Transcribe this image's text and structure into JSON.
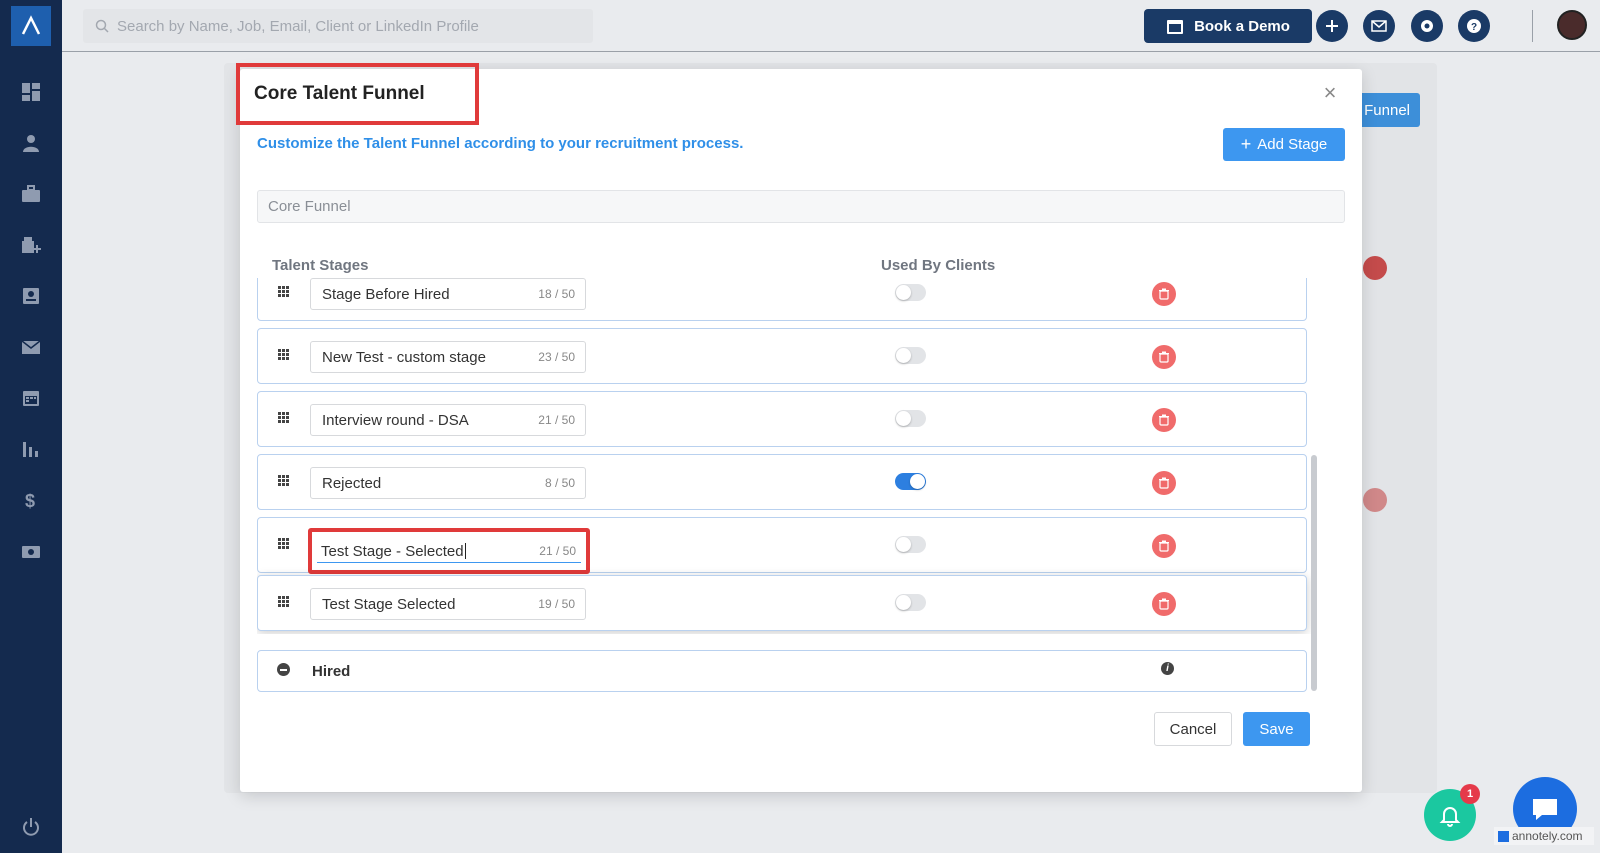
{
  "topbar": {
    "search_placeholder": "Search by Name, Job, Email, Client or LinkedIn Profile",
    "demo_label": "Book a Demo"
  },
  "background": {
    "button_label": "Funnel"
  },
  "modal": {
    "title": "Core Talent Funnel",
    "subtitle": "Customize the Talent Funnel according to your recruitment process.",
    "add_stage_label": "Add Stage",
    "funnel_name": "Core Funnel",
    "col_stages": "Talent Stages",
    "col_clients": "Used By Clients",
    "stages": [
      {
        "name": "Stage Before Hired",
        "count": "18 / 50",
        "used_by_clients": false
      },
      {
        "name": "New Test - custom stage",
        "count": "23 / 50",
        "used_by_clients": false
      },
      {
        "name": "Interview round - DSA",
        "count": "21 / 50",
        "used_by_clients": false
      },
      {
        "name": "Rejected",
        "count": "8 / 50",
        "used_by_clients": true
      },
      {
        "name": "Test Stage - Selected",
        "count": "21 / 50",
        "used_by_clients": false,
        "editing": true
      },
      {
        "name": "Test Stage Selected",
        "count": "19 / 50",
        "used_by_clients": false
      }
    ],
    "hired_label": "Hired",
    "cancel_label": "Cancel",
    "save_label": "Save"
  },
  "notifications": {
    "count": "1"
  },
  "watermark": "annotely.com",
  "colors": {
    "sidebar": "#142a4e",
    "accent": "#3d97f0",
    "highlight": "#e03a3a",
    "delete": "#f06b6b",
    "toggle_on": "#2d7fe0"
  }
}
